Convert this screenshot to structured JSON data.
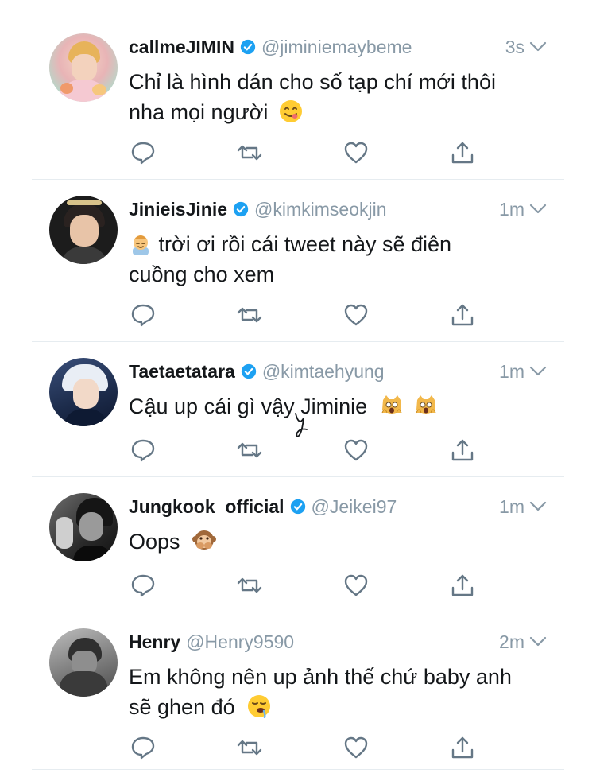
{
  "tweets": [
    {
      "name": "callmeJIMIN",
      "verified": true,
      "handle": "@jiminiemaybeme",
      "time": "3s",
      "line1": "Chỉ là hình dán cho số tạp chí mới thôi",
      "line2": "nha mọi người",
      "emoji": "yum-face-emoji"
    },
    {
      "name": "JinieisJinie",
      "verified": true,
      "handle": "@kimkimseokjin",
      "time": "1m",
      "line1": " trời ơi rồi cái tweet này sẽ điên",
      "line2": "cuồng cho xem",
      "emoji": "face-massage-emoji"
    },
    {
      "name": "Taetaetatara",
      "verified": true,
      "handle": "@kimtaehyung",
      "time": "1m",
      "line1": "Cậu up cái gì vậy Jiminie",
      "line2": "",
      "emoji": "weary-cat-emoji"
    },
    {
      "name": "Jungkook_official",
      "verified": true,
      "handle": "@Jeikei97",
      "time": "1m",
      "line1": "Oops",
      "line2": "",
      "emoji": "speak-no-evil-monkey-emoji"
    },
    {
      "name": "Henry",
      "verified": false,
      "handle": "@Henry9590",
      "time": "2m",
      "line1": "Em không nên up ảnh thế chứ baby anh",
      "line2": "sẽ ghen đó",
      "emoji": "drooling-face-emoji"
    }
  ],
  "icons": {
    "reply": "reply-icon",
    "retweet": "retweet-icon",
    "like": "heart-icon",
    "share": "share-icon",
    "caret": "chevron-down-icon",
    "verified": "verified-badge-icon"
  },
  "colors": {
    "text": "#14171a",
    "secondary": "#8899a6",
    "verified": "#1da1f2",
    "icon": "#657786",
    "divider": "#e6ecf0"
  }
}
